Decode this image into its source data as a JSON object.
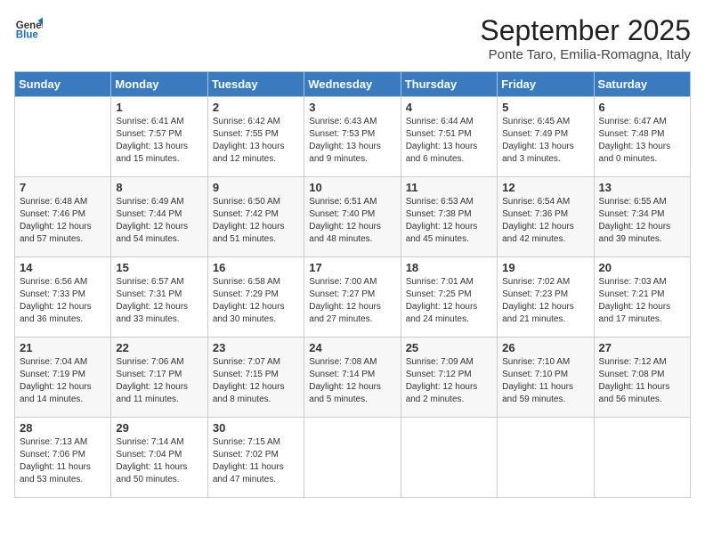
{
  "logo": {
    "line1": "General",
    "line2": "Blue"
  },
  "title": "September 2025",
  "subtitle": "Ponte Taro, Emilia-Romagna, Italy",
  "weekdays": [
    "Sunday",
    "Monday",
    "Tuesday",
    "Wednesday",
    "Thursday",
    "Friday",
    "Saturday"
  ],
  "weeks": [
    [
      {
        "day": "",
        "sunrise": "",
        "sunset": "",
        "daylight": ""
      },
      {
        "day": "1",
        "sunrise": "Sunrise: 6:41 AM",
        "sunset": "Sunset: 7:57 PM",
        "daylight": "Daylight: 13 hours and 15 minutes."
      },
      {
        "day": "2",
        "sunrise": "Sunrise: 6:42 AM",
        "sunset": "Sunset: 7:55 PM",
        "daylight": "Daylight: 13 hours and 12 minutes."
      },
      {
        "day": "3",
        "sunrise": "Sunrise: 6:43 AM",
        "sunset": "Sunset: 7:53 PM",
        "daylight": "Daylight: 13 hours and 9 minutes."
      },
      {
        "day": "4",
        "sunrise": "Sunrise: 6:44 AM",
        "sunset": "Sunset: 7:51 PM",
        "daylight": "Daylight: 13 hours and 6 minutes."
      },
      {
        "day": "5",
        "sunrise": "Sunrise: 6:45 AM",
        "sunset": "Sunset: 7:49 PM",
        "daylight": "Daylight: 13 hours and 3 minutes."
      },
      {
        "day": "6",
        "sunrise": "Sunrise: 6:47 AM",
        "sunset": "Sunset: 7:48 PM",
        "daylight": "Daylight: 13 hours and 0 minutes."
      }
    ],
    [
      {
        "day": "7",
        "sunrise": "Sunrise: 6:48 AM",
        "sunset": "Sunset: 7:46 PM",
        "daylight": "Daylight: 12 hours and 57 minutes."
      },
      {
        "day": "8",
        "sunrise": "Sunrise: 6:49 AM",
        "sunset": "Sunset: 7:44 PM",
        "daylight": "Daylight: 12 hours and 54 minutes."
      },
      {
        "day": "9",
        "sunrise": "Sunrise: 6:50 AM",
        "sunset": "Sunset: 7:42 PM",
        "daylight": "Daylight: 12 hours and 51 minutes."
      },
      {
        "day": "10",
        "sunrise": "Sunrise: 6:51 AM",
        "sunset": "Sunset: 7:40 PM",
        "daylight": "Daylight: 12 hours and 48 minutes."
      },
      {
        "day": "11",
        "sunrise": "Sunrise: 6:53 AM",
        "sunset": "Sunset: 7:38 PM",
        "daylight": "Daylight: 12 hours and 45 minutes."
      },
      {
        "day": "12",
        "sunrise": "Sunrise: 6:54 AM",
        "sunset": "Sunset: 7:36 PM",
        "daylight": "Daylight: 12 hours and 42 minutes."
      },
      {
        "day": "13",
        "sunrise": "Sunrise: 6:55 AM",
        "sunset": "Sunset: 7:34 PM",
        "daylight": "Daylight: 12 hours and 39 minutes."
      }
    ],
    [
      {
        "day": "14",
        "sunrise": "Sunrise: 6:56 AM",
        "sunset": "Sunset: 7:33 PM",
        "daylight": "Daylight: 12 hours and 36 minutes."
      },
      {
        "day": "15",
        "sunrise": "Sunrise: 6:57 AM",
        "sunset": "Sunset: 7:31 PM",
        "daylight": "Daylight: 12 hours and 33 minutes."
      },
      {
        "day": "16",
        "sunrise": "Sunrise: 6:58 AM",
        "sunset": "Sunset: 7:29 PM",
        "daylight": "Daylight: 12 hours and 30 minutes."
      },
      {
        "day": "17",
        "sunrise": "Sunrise: 7:00 AM",
        "sunset": "Sunset: 7:27 PM",
        "daylight": "Daylight: 12 hours and 27 minutes."
      },
      {
        "day": "18",
        "sunrise": "Sunrise: 7:01 AM",
        "sunset": "Sunset: 7:25 PM",
        "daylight": "Daylight: 12 hours and 24 minutes."
      },
      {
        "day": "19",
        "sunrise": "Sunrise: 7:02 AM",
        "sunset": "Sunset: 7:23 PM",
        "daylight": "Daylight: 12 hours and 21 minutes."
      },
      {
        "day": "20",
        "sunrise": "Sunrise: 7:03 AM",
        "sunset": "Sunset: 7:21 PM",
        "daylight": "Daylight: 12 hours and 17 minutes."
      }
    ],
    [
      {
        "day": "21",
        "sunrise": "Sunrise: 7:04 AM",
        "sunset": "Sunset: 7:19 PM",
        "daylight": "Daylight: 12 hours and 14 minutes."
      },
      {
        "day": "22",
        "sunrise": "Sunrise: 7:06 AM",
        "sunset": "Sunset: 7:17 PM",
        "daylight": "Daylight: 12 hours and 11 minutes."
      },
      {
        "day": "23",
        "sunrise": "Sunrise: 7:07 AM",
        "sunset": "Sunset: 7:15 PM",
        "daylight": "Daylight: 12 hours and 8 minutes."
      },
      {
        "day": "24",
        "sunrise": "Sunrise: 7:08 AM",
        "sunset": "Sunset: 7:14 PM",
        "daylight": "Daylight: 12 hours and 5 minutes."
      },
      {
        "day": "25",
        "sunrise": "Sunrise: 7:09 AM",
        "sunset": "Sunset: 7:12 PM",
        "daylight": "Daylight: 12 hours and 2 minutes."
      },
      {
        "day": "26",
        "sunrise": "Sunrise: 7:10 AM",
        "sunset": "Sunset: 7:10 PM",
        "daylight": "Daylight: 11 hours and 59 minutes."
      },
      {
        "day": "27",
        "sunrise": "Sunrise: 7:12 AM",
        "sunset": "Sunset: 7:08 PM",
        "daylight": "Daylight: 11 hours and 56 minutes."
      }
    ],
    [
      {
        "day": "28",
        "sunrise": "Sunrise: 7:13 AM",
        "sunset": "Sunset: 7:06 PM",
        "daylight": "Daylight: 11 hours and 53 minutes."
      },
      {
        "day": "29",
        "sunrise": "Sunrise: 7:14 AM",
        "sunset": "Sunset: 7:04 PM",
        "daylight": "Daylight: 11 hours and 50 minutes."
      },
      {
        "day": "30",
        "sunrise": "Sunrise: 7:15 AM",
        "sunset": "Sunset: 7:02 PM",
        "daylight": "Daylight: 11 hours and 47 minutes."
      },
      {
        "day": "",
        "sunrise": "",
        "sunset": "",
        "daylight": ""
      },
      {
        "day": "",
        "sunrise": "",
        "sunset": "",
        "daylight": ""
      },
      {
        "day": "",
        "sunrise": "",
        "sunset": "",
        "daylight": ""
      },
      {
        "day": "",
        "sunrise": "",
        "sunset": "",
        "daylight": ""
      }
    ]
  ]
}
